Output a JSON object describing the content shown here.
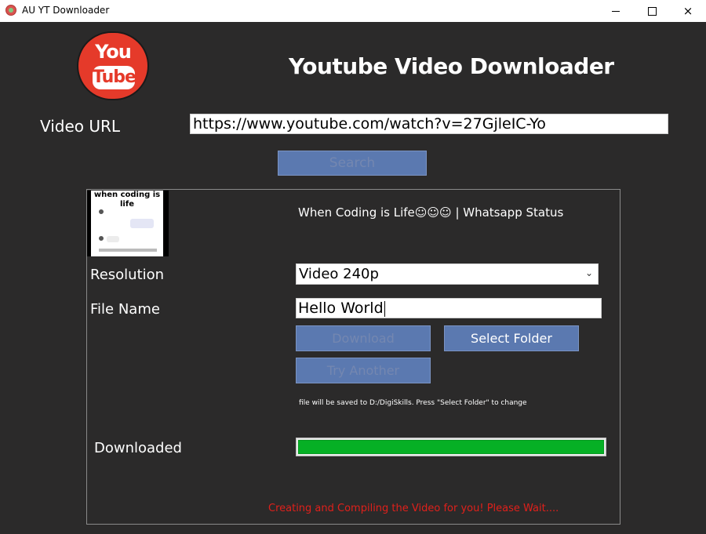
{
  "window": {
    "title": "AU YT Downloader",
    "controls": {
      "minimize": "minimize",
      "maximize": "maximize",
      "close": "×"
    }
  },
  "logo": {
    "line1": "You",
    "line2": "Tube"
  },
  "heading": "Youtube Video Downloader",
  "url": {
    "label": "Video URL",
    "value": "https://www.youtube.com/watch?v=27GjleIC-Yo"
  },
  "search_button": "Search",
  "video": {
    "thumbnail_text": "when coding is life",
    "title": "When Coding is Life☺☺☺ | Whatsapp Status"
  },
  "resolution": {
    "label": "Resolution",
    "selected": "Video 240p"
  },
  "file_name": {
    "label": "File Name",
    "value": "Hello World"
  },
  "buttons": {
    "download": "Download",
    "select_folder": "Select Folder",
    "try_another": "Try Another"
  },
  "save_note": "file will be saved to D:/DigiSkills. Press \"Select Folder\" to change",
  "download_progress": {
    "label": "Downloaded",
    "fraction": 1.0,
    "color": "#06b025"
  },
  "status_message": "Creating and Compiling the Video for you! Please Wait....",
  "colors": {
    "background": "#2b2a2a",
    "button": "#5b79b0",
    "status": "#e0201b",
    "logo": "#e53a2a"
  }
}
